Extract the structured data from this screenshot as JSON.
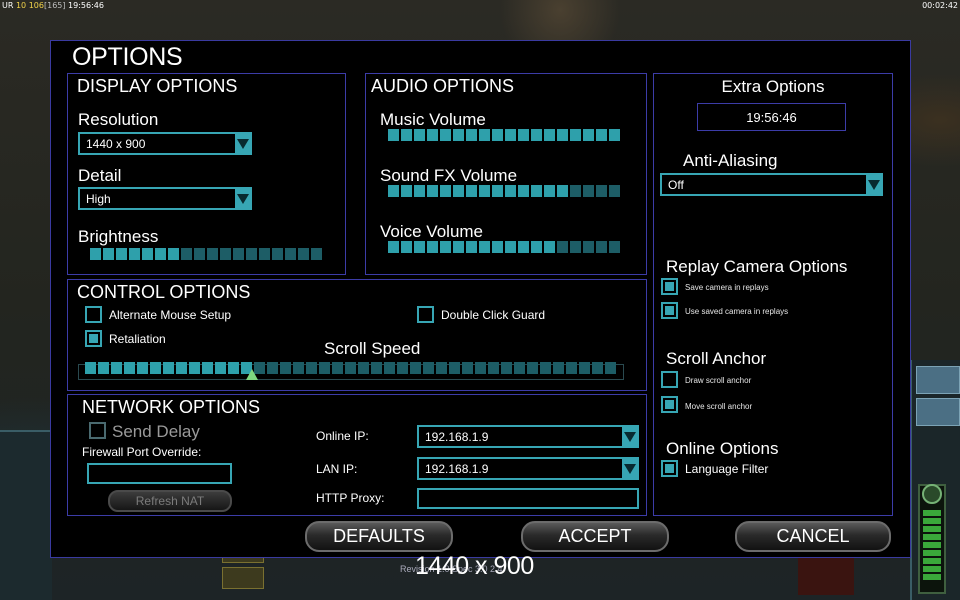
{
  "hud": {
    "left_prefix": "UR",
    "left_value1": "10",
    "left_value2": "106",
    "left_bracket": "[165]",
    "left_time": "19:56:46",
    "right_time": "00:02:42"
  },
  "options": {
    "title": "OPTIONS",
    "display": {
      "title": "DISPLAY OPTIONS",
      "resolution_label": "Resolution",
      "resolution_value": "1440 x 900",
      "detail_label": "Detail",
      "detail_value": "High",
      "brightness_label": "Brightness",
      "brightness_level": 0.4
    },
    "audio": {
      "title": "AUDIO OPTIONS",
      "music_label": "Music Volume",
      "music_level": 1.0,
      "sfx_label": "Sound FX Volume",
      "sfx_level": 0.8,
      "voice_label": "Voice Volume",
      "voice_level": 0.7
    },
    "extra": {
      "title": "Extra Options",
      "clock": "19:56:46",
      "aa_label": "Anti-Aliasing",
      "aa_value": "Off",
      "replay_title": "Replay Camera Options",
      "save_camera": "Save camera in replays",
      "use_saved_camera": "Use saved camera in replays",
      "scroll_anchor_title": "Scroll Anchor",
      "draw_scroll_anchor": "Draw scroll anchor",
      "move_scroll_anchor": "Move scroll anchor",
      "online_title": "Online Options",
      "language_filter": "Language Filter"
    },
    "control": {
      "title": "CONTROL OPTIONS",
      "alt_mouse": "Alternate Mouse Setup",
      "double_click": "Double Click Guard",
      "retaliation": "Retaliation",
      "scroll_speed_label": "Scroll Speed",
      "scroll_speed_level": 0.32
    },
    "network": {
      "title": "NETWORK OPTIONS",
      "send_delay": "Send Delay",
      "firewall_label": "Firewall Port Override:",
      "firewall_value": "",
      "refresh_nat": "Refresh NAT",
      "online_ip_label": "Online IP:",
      "online_ip_value": "192.168.1.9",
      "lan_ip_label": "LAN IP:",
      "lan_ip_value": "192.168.1.9",
      "http_proxy_label": "HTTP Proxy:",
      "http_proxy_value": ""
    },
    "buttons": {
      "defaults": "DEFAULTS",
      "accept": "ACCEPT",
      "cancel": "CANCEL"
    }
  },
  "overlay": {
    "resolution": "1440 x 900",
    "revision": "Revision 1.0 Spec 3.0 2 4"
  },
  "colors": {
    "accent": "#37a6b4",
    "slider_on": "#2ea0ab",
    "slider_off": "#1d5d66",
    "panel_border": "#3c3ca8"
  }
}
